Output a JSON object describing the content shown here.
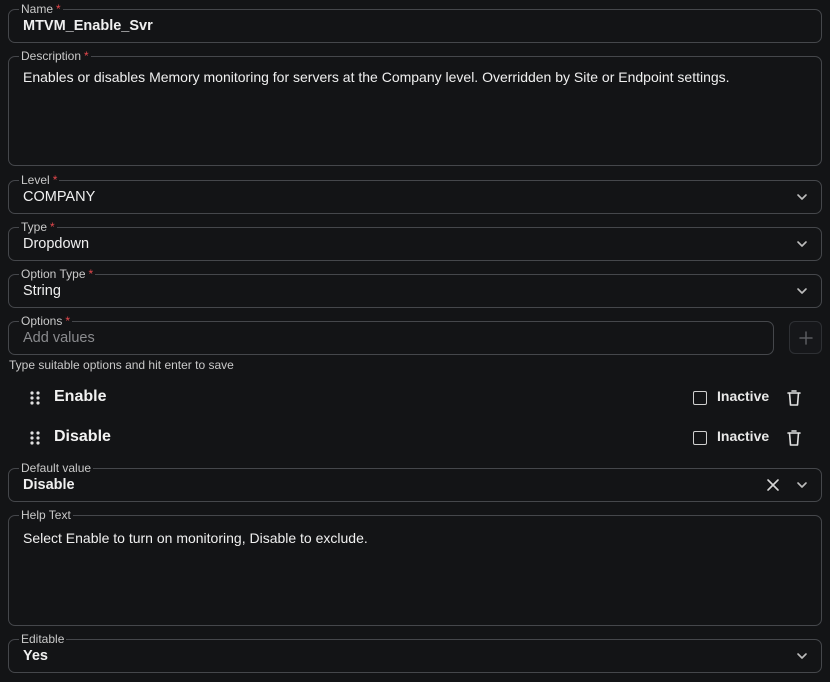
{
  "fields": {
    "name": {
      "label": "Name",
      "required_mark": "*",
      "value": "MTVM_Enable_Svr"
    },
    "description": {
      "label": "Description",
      "required_mark": "*",
      "value": "Enables or disables Memory monitoring for servers at the Company level. Overridden by Site or Endpoint settings."
    },
    "level": {
      "label": "Level",
      "required_mark": "*",
      "value": "COMPANY"
    },
    "type": {
      "label": "Type",
      "required_mark": "*",
      "value": "Dropdown"
    },
    "option_type": {
      "label": "Option Type",
      "required_mark": "*",
      "value": "String"
    },
    "options": {
      "label": "Options",
      "required_mark": "*",
      "placeholder": "Add values",
      "hint": "Type suitable options and hit enter to save",
      "items": [
        {
          "label": "Enable",
          "inactive_label": "Inactive",
          "inactive_checked": false
        },
        {
          "label": "Disable",
          "inactive_label": "Inactive",
          "inactive_checked": false
        }
      ]
    },
    "default_value": {
      "label": "Default value",
      "value": "Disable"
    },
    "help_text": {
      "label": "Help Text",
      "value": "Select Enable to turn on monitoring, Disable to exclude."
    },
    "editable": {
      "label": "Editable",
      "value": "Yes"
    }
  },
  "icons": {
    "dropdown": "chevron-down-icon",
    "clear": "close-icon",
    "add": "plus-icon",
    "drag": "drag-handle-icon",
    "delete": "trash-icon"
  },
  "colors": {
    "background": "#131416",
    "border": "#45474b",
    "required": "#e5484d",
    "text": "#f0f0f0",
    "muted": "#c9c9c9"
  }
}
